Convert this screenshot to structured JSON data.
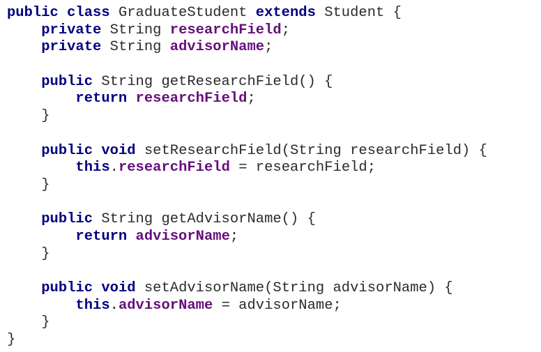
{
  "editor": {
    "colors": {
      "background": "#ffffff",
      "keyword": "#000080",
      "field": "#660e7a",
      "plain": "#2b2b2b"
    },
    "lines": [
      [
        {
          "t": "public",
          "k": "keyword"
        },
        {
          "t": " ",
          "k": "plain"
        },
        {
          "t": "class",
          "k": "keyword"
        },
        {
          "t": " GraduateStudent ",
          "k": "plain"
        },
        {
          "t": "extends",
          "k": "keyword"
        },
        {
          "t": " Student {",
          "k": "plain"
        }
      ],
      [
        {
          "t": "    ",
          "k": "plain"
        },
        {
          "t": "private",
          "k": "keyword"
        },
        {
          "t": " String ",
          "k": "plain"
        },
        {
          "t": "researchField",
          "k": "field"
        },
        {
          "t": ";",
          "k": "plain"
        }
      ],
      [
        {
          "t": "    ",
          "k": "plain"
        },
        {
          "t": "private",
          "k": "keyword"
        },
        {
          "t": " String ",
          "k": "plain"
        },
        {
          "t": "advisorName",
          "k": "field"
        },
        {
          "t": ";",
          "k": "plain"
        }
      ],
      [],
      [
        {
          "t": "    ",
          "k": "plain"
        },
        {
          "t": "public",
          "k": "keyword"
        },
        {
          "t": " String getResearchField() {",
          "k": "plain"
        }
      ],
      [
        {
          "t": "        ",
          "k": "plain"
        },
        {
          "t": "return",
          "k": "keyword"
        },
        {
          "t": " ",
          "k": "plain"
        },
        {
          "t": "researchField",
          "k": "field"
        },
        {
          "t": ";",
          "k": "plain"
        }
      ],
      [
        {
          "t": "    }",
          "k": "plain"
        }
      ],
      [],
      [
        {
          "t": "    ",
          "k": "plain"
        },
        {
          "t": "public",
          "k": "keyword"
        },
        {
          "t": " ",
          "k": "plain"
        },
        {
          "t": "void",
          "k": "keyword"
        },
        {
          "t": " setResearchField(String researchField) {",
          "k": "plain"
        }
      ],
      [
        {
          "t": "        ",
          "k": "plain"
        },
        {
          "t": "this",
          "k": "keyword"
        },
        {
          "t": ".",
          "k": "plain"
        },
        {
          "t": "researchField",
          "k": "field"
        },
        {
          "t": " = researchField;",
          "k": "plain"
        }
      ],
      [
        {
          "t": "    }",
          "k": "plain"
        }
      ],
      [],
      [
        {
          "t": "    ",
          "k": "plain"
        },
        {
          "t": "public",
          "k": "keyword"
        },
        {
          "t": " String getAdvisorName() {",
          "k": "plain"
        }
      ],
      [
        {
          "t": "        ",
          "k": "plain"
        },
        {
          "t": "return",
          "k": "keyword"
        },
        {
          "t": " ",
          "k": "plain"
        },
        {
          "t": "advisorName",
          "k": "field"
        },
        {
          "t": ";",
          "k": "plain"
        }
      ],
      [
        {
          "t": "    }",
          "k": "plain"
        }
      ],
      [],
      [
        {
          "t": "    ",
          "k": "plain"
        },
        {
          "t": "public",
          "k": "keyword"
        },
        {
          "t": " ",
          "k": "plain"
        },
        {
          "t": "void",
          "k": "keyword"
        },
        {
          "t": " setAdvisorName(String advisorName) {",
          "k": "plain"
        }
      ],
      [
        {
          "t": "        ",
          "k": "plain"
        },
        {
          "t": "this",
          "k": "keyword"
        },
        {
          "t": ".",
          "k": "plain"
        },
        {
          "t": "advisorName",
          "k": "field"
        },
        {
          "t": " = advisorName;",
          "k": "plain"
        }
      ],
      [
        {
          "t": "    }",
          "k": "plain"
        }
      ],
      [
        {
          "t": "}",
          "k": "plain"
        }
      ]
    ]
  }
}
